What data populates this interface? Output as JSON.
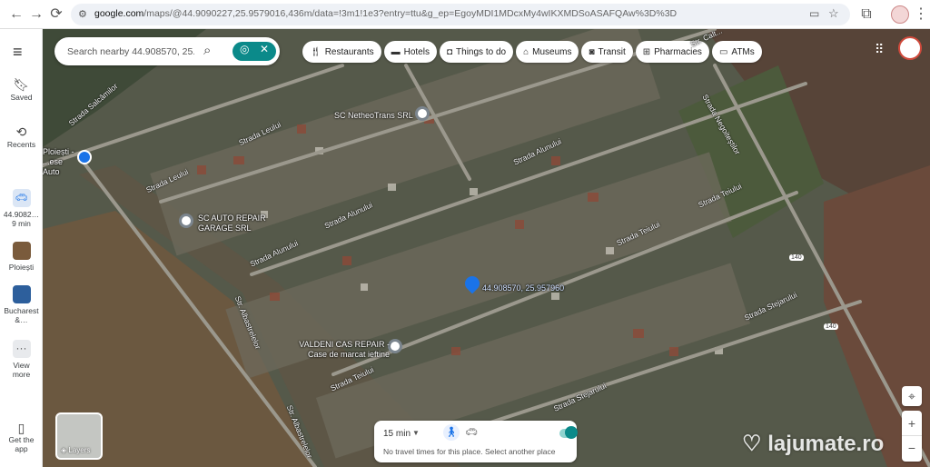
{
  "browser": {
    "url_host": "google.com",
    "url_path": "/maps/@44.9090227,25.9579016,436m/data=!3m1!1e3?entry=ttu&g_ep=EgoyMDI1MDcxMy4wIKXMDSoASAFQAw%3D%3D"
  },
  "sidebar": {
    "items": [
      {
        "label": "Saved"
      },
      {
        "label": "Recents"
      },
      {
        "label": "44.9082… 9 min"
      },
      {
        "label": "Ploiești"
      },
      {
        "label": "Bucharest &…"
      },
      {
        "label": "View more"
      },
      {
        "label": "Get the app"
      }
    ]
  },
  "search": {
    "placeholder": "Search nearby 44.908570, 25.95"
  },
  "chips": [
    {
      "label": "Restaurants",
      "icon": "fork-knife-icon"
    },
    {
      "label": "Hotels",
      "icon": "bed-icon"
    },
    {
      "label": "Things to do",
      "icon": "camera-icon"
    },
    {
      "label": "Museums",
      "icon": "museum-icon"
    },
    {
      "label": "Transit",
      "icon": "bus-icon"
    },
    {
      "label": "Pharmacies",
      "icon": "pharmacy-icon"
    },
    {
      "label": "ATMs",
      "icon": "atm-icon"
    }
  ],
  "map": {
    "pois": [
      {
        "name": "SC NetheoTrans SRL"
      },
      {
        "name": "SC AUTO REPAIR GARAGE SRL"
      },
      {
        "name": "VALDENI CAS REPAIR - Case de marcat ieftine"
      },
      {
        "name": "Ploiești - ...ese Auto"
      }
    ],
    "pin_label": "44.908570, 25.957960",
    "streets": [
      "Strada Salcâmilor",
      "Strada Leului",
      "Strada Alunului",
      "Strada Teiului",
      "Strada Stejarului",
      "Str. Albastrelelor",
      "Strada Negoiteștilor",
      "Str. Calt..."
    ],
    "road_number": "140"
  },
  "layers": {
    "label": "Layers"
  },
  "travel": {
    "duration": "15 min",
    "note": "No travel times for this place. Select another place"
  },
  "watermark": "lajumate.ro",
  "colors": {
    "accent": "#1a73e8",
    "teal": "#0b8a8a"
  }
}
